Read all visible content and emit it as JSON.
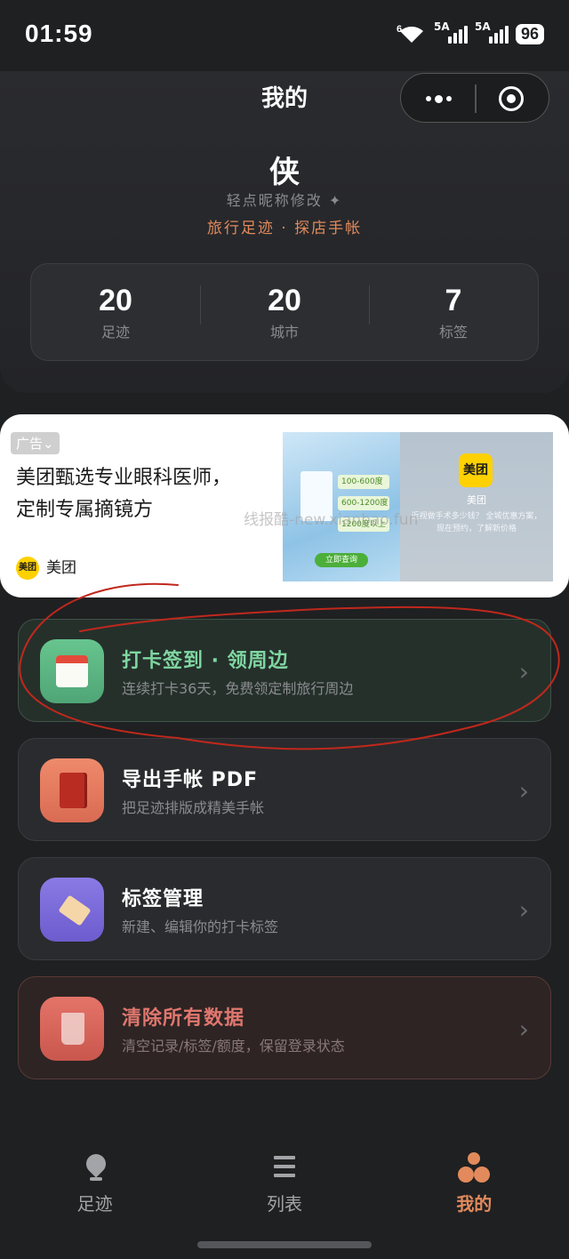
{
  "status_bar": {
    "time": "01:59",
    "wifi_label": "6",
    "signal1_label": "5A",
    "signal2_label": "5A",
    "battery": "96"
  },
  "header": {
    "title": "我的",
    "nickname": "侠",
    "edit_hint": "轻点昵称修改 ✦",
    "tagline": "旅行足迹 · 探店手帐"
  },
  "stats": [
    {
      "value": "20",
      "label": "足迹"
    },
    {
      "value": "20",
      "label": "城市"
    },
    {
      "value": "7",
      "label": "标签"
    }
  ],
  "ad": {
    "badge": "广告⌄",
    "text": "美团甄选专业眼科医师，定制专属摘镜方",
    "brand_logo": "美团",
    "brand": "美团",
    "img_rows": [
      "100-600度",
      "600-1200度",
      "1200度以上"
    ],
    "img_cta": "立即查询",
    "panel_logo": "美团",
    "panel_name": "美团",
    "panel_desc": "近视做手术多少钱？ 全城优惠方案，现在预约，了解新价格",
    "watermark": "线报酷-new.xianbao.fun"
  },
  "menu": [
    {
      "title": "打卡签到 · 领周边",
      "subtitle": "连续打卡36天，免费领定制旅行周边"
    },
    {
      "title": "导出手帐 PDF",
      "subtitle": "把足迹排版成精美手帐"
    },
    {
      "title": "标签管理",
      "subtitle": "新建、编辑你的打卡标签"
    },
    {
      "title": "清除所有数据",
      "subtitle": "清空记录/标签/额度，保留登录状态"
    }
  ],
  "tabs": [
    {
      "label": "足迹"
    },
    {
      "label": "列表"
    },
    {
      "label": "我的"
    }
  ],
  "colors": {
    "accent": "#e28a5c",
    "checkin_green": "#7fd6a1",
    "danger_red": "#e0776e",
    "annotation_red": "#c0281c"
  }
}
